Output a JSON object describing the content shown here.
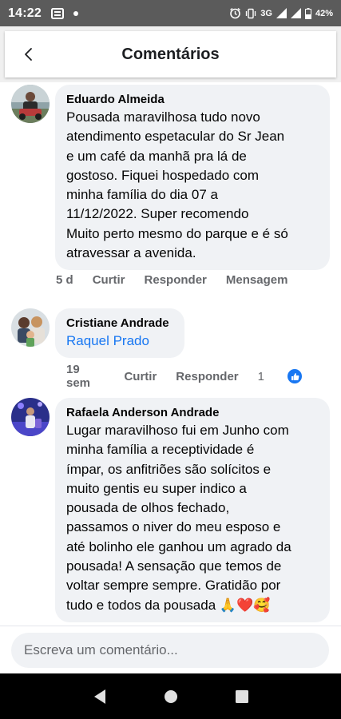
{
  "status_bar": {
    "time": "14:22",
    "network": "3G",
    "battery": "42%"
  },
  "header": {
    "title": "Comentários"
  },
  "comments": [
    {
      "author": "Eduardo Almeida",
      "text_lines": [
        "Pousada maravilhosa tudo novo",
        "atendimento espetacular do Sr Jean",
        "e um café da manhã pra lá de",
        "gostoso. Fiquei hospedado com",
        "minha família do dia 07 a",
        "11/12/2022. Super recomendo",
        "Muito perto mesmo do parque e é só",
        "atravessar a avenida."
      ],
      "time": "5 d",
      "actions": [
        "Curtir",
        "Responder",
        "Mensagem"
      ]
    },
    {
      "author": "Cristiane Andrade",
      "tag": "Raquel Prado",
      "time": "19 sem",
      "actions": [
        "Curtir",
        "Responder"
      ],
      "likes": "1"
    },
    {
      "author": "Rafaela Anderson Andrade",
      "text_lines": [
        "Lugar maravilhoso fui em Junho com",
        "minha família a receptividade é",
        "ímpar, os anfitriões são solícitos e",
        "muito gentis eu super indico a",
        "pousada de olhos fechado,",
        "passamos o niver do meu esposo e",
        "até bolinho ele ganhou um agrado da",
        "pousada! A sensação que temos de",
        "voltar sempre sempre. Gratidão por",
        "tudo e todos da pousada 🙏❤️🥰"
      ]
    }
  ],
  "input": {
    "placeholder": "Escreva um comentário..."
  },
  "colors": {
    "link": "#1877f2",
    "bubble": "#f0f2f5",
    "meta": "#65676b"
  }
}
